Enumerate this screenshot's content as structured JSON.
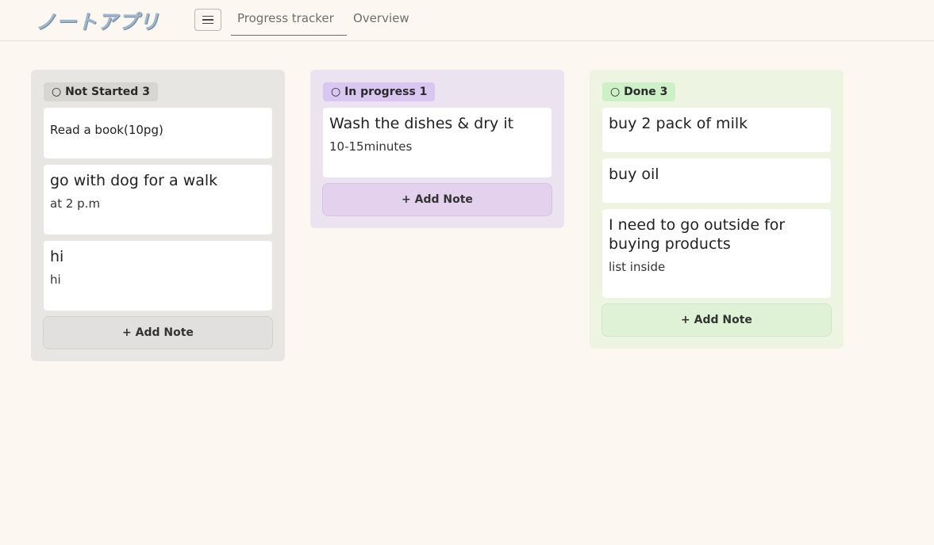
{
  "app": {
    "title": "ノートアプリ"
  },
  "nav": {
    "tabs": [
      {
        "label": "Progress tracker",
        "active": true
      },
      {
        "label": "Overview",
        "active": false
      }
    ]
  },
  "columns": [
    {
      "badge": "○ Not Started 3",
      "color": "#e8e6e3",
      "add_label": "+ Add Note",
      "cards": [
        {
          "title": "Read a book(10pg)",
          "subtitle": ""
        },
        {
          "title": "go with dog for a walk",
          "subtitle": "at 2 p.m"
        },
        {
          "title": "hi",
          "subtitle": "hi"
        }
      ]
    },
    {
      "badge": "○ In progress 1",
      "color": "#ebe3f0",
      "add_label": "+ Add Note",
      "cards": [
        {
          "title": "Wash the dishes & dry it",
          "subtitle": "10-15minutes"
        }
      ]
    },
    {
      "badge": "○ Done 3",
      "color": "#eef4e2",
      "add_label": "+ Add Note",
      "cards": [
        {
          "title": "buy 2 pack of milk",
          "subtitle": ""
        },
        {
          "title": "buy oil",
          "subtitle": ""
        },
        {
          "title": "I need to go outside for buying products",
          "subtitle": "list inside"
        }
      ]
    }
  ]
}
